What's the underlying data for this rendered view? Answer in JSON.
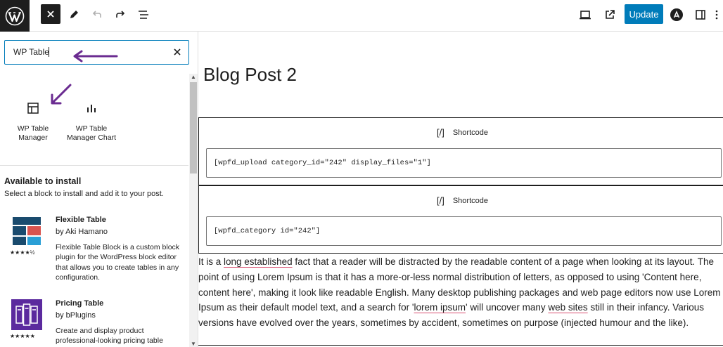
{
  "topbar": {
    "update_label": "Update",
    "icons": [
      "wordpress-logo-icon",
      "close-icon",
      "pencil-icon",
      "undo-icon",
      "redo-icon",
      "list-view-icon",
      "desktop-preview-icon",
      "external-link-icon",
      "astra-logo-icon",
      "settings-sidebar-icon",
      "more-options-icon"
    ]
  },
  "sidebar": {
    "search_value": "WP Table",
    "blocks": [
      {
        "label_line1": "WP Table",
        "label_line2": "Manager"
      },
      {
        "label_line1": "WP Table",
        "label_line2": "Manager Chart"
      }
    ],
    "available_title": "Available to install",
    "available_subtitle": "Select a block to install and add it to your post.",
    "plugins": [
      {
        "name": "Flexible Table",
        "author": "by Aki Hamano",
        "desc": "Flexible Table Block is a custom block plugin for the WordPress block editor that allows you to create tables in any configuration.",
        "stars": "★★★★½"
      },
      {
        "name": "Pricing Table",
        "author": "by bPlugins",
        "desc": "Create and display product professional-looking pricing table",
        "stars": "★★★★★"
      }
    ]
  },
  "canvas": {
    "title": "Blog Post 2",
    "shortcodes": [
      {
        "label": "Shortcode",
        "glyph": "[/]",
        "value": "[wpfd_upload category_id=\"242\" display_files=\"1\"]"
      },
      {
        "label": "Shortcode",
        "glyph": "[/]",
        "value": "[wpfd_category id=\"242\"]"
      }
    ],
    "paragraph": {
      "p1": "It is a ",
      "s1": "long established",
      "p2": " fact that a reader will be distracted by the readable content of a page when looking at its layout. The point of using Lorem Ipsum is that it has a more-or-less normal distribution of letters, as opposed to using 'Content here, content here', making it look like readable English. Many desktop publishing packages and web page editors now use Lorem Ipsum as their default model text, and a search for '",
      "s2": "lorem ipsum",
      "p3": "' will uncover many ",
      "s3": "web sites",
      "p4": " still in their infancy. Various versions have evolved over the years, sometimes by accident, sometimes on purpose (injected humour and the like)."
    }
  },
  "colors": {
    "accent": "#007cba",
    "dark": "#1e1e1e",
    "annotation_arrow": "#6b2c91",
    "spellcheck": "#d94f70"
  }
}
